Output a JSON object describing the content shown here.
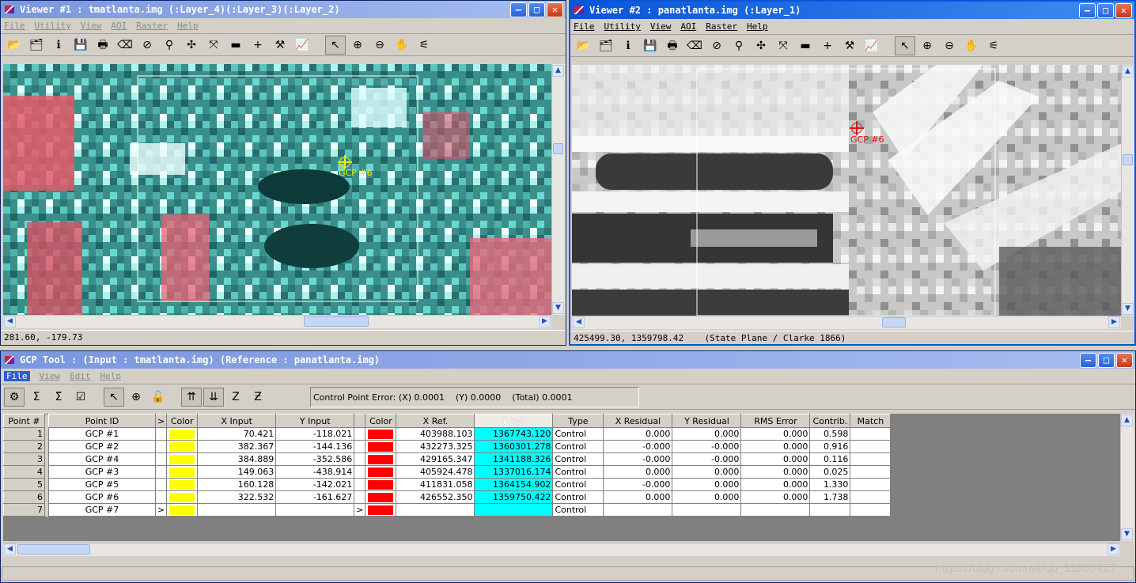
{
  "viewer1": {
    "title": "Viewer #1 : tmatlanta.img (:Layer_4)(:Layer_3)(:Layer_2)",
    "menu": [
      "File",
      "Utility",
      "View",
      "AOI",
      "Raster",
      "Help"
    ],
    "gcp_label": "GCP #6",
    "gcp_color": "#f0f000",
    "status": "281.60, -179.73"
  },
  "viewer2": {
    "title": "Viewer #2 : panatlanta.img (:Layer_1)",
    "menu": [
      "File",
      "Utility",
      "View",
      "AOI",
      "Raster",
      "Help"
    ],
    "gcp_label": "GCP #6",
    "gcp_color": "#e01010",
    "status": "425499.30, 1359798.42    (State Plane / Clarke 1866)"
  },
  "gcp_tool": {
    "title": "GCP Tool : (Input : tmatlanta.img) (Reference : panatlanta.img)",
    "menu": [
      "File",
      "View",
      "Edit",
      "Help"
    ],
    "error_label": "Control Point Error: (X) 0.0001",
    "error_y": "(Y) 0.0000",
    "error_total": "(Total) 0.0001",
    "columns": [
      "Point #",
      "Point ID",
      ">",
      "Color",
      "X Input",
      "Y Input",
      "Color",
      "X Ref.",
      "Y Ref.",
      "Type",
      "X Residual",
      "Y Residual",
      "RMS Error",
      "Contrib.",
      "Match"
    ],
    "input_color": "#ffff00",
    "ref_color": "#ff0000",
    "rows": [
      {
        "num": "1",
        "id": "GCP #1",
        "arrow": "",
        "xin": "70.421",
        "yin": "-118.021",
        "arrow2": "",
        "xref": "403988.103",
        "yref": "1367743.120",
        "type": "Control",
        "xres": "0.000",
        "yres": "0.000",
        "rms": "0.000",
        "contrib": "0.598"
      },
      {
        "num": "2",
        "id": "GCP #2",
        "arrow": "",
        "xin": "382.367",
        "yin": "-144.136",
        "arrow2": "",
        "xref": "432273.325",
        "yref": "1360301.278",
        "type": "Control",
        "xres": "-0.000",
        "yres": "-0.000",
        "rms": "0.000",
        "contrib": "0.916"
      },
      {
        "num": "3",
        "id": "GCP #4",
        "arrow": "",
        "xin": "384.889",
        "yin": "-352.586",
        "arrow2": "",
        "xref": "429165.347",
        "yref": "1341188.326",
        "type": "Control",
        "xres": "-0.000",
        "yres": "-0.000",
        "rms": "0.000",
        "contrib": "0.116"
      },
      {
        "num": "4",
        "id": "GCP #3",
        "arrow": "",
        "xin": "149.063",
        "yin": "-438.914",
        "arrow2": "",
        "xref": "405924.478",
        "yref": "1337016.174",
        "type": "Control",
        "xres": "0.000",
        "yres": "0.000",
        "rms": "0.000",
        "contrib": "0.025"
      },
      {
        "num": "5",
        "id": "GCP #5",
        "arrow": "",
        "xin": "160.128",
        "yin": "-142.021",
        "arrow2": "",
        "xref": "411831.058",
        "yref": "1364154.902",
        "type": "Control",
        "xres": "-0.000",
        "yres": "0.000",
        "rms": "0.000",
        "contrib": "1.330"
      },
      {
        "num": "6",
        "id": "GCP #6",
        "arrow": "",
        "xin": "322.532",
        "yin": "-161.627",
        "arrow2": "",
        "xref": "426552.350",
        "yref": "1359750.422",
        "type": "Control",
        "xres": "0.000",
        "yres": "0.000",
        "rms": "0.000",
        "contrib": "1.738"
      },
      {
        "num": "7",
        "id": "GCP #7",
        "arrow": ">",
        "xin": "",
        "yin": "",
        "arrow2": ">",
        "xref": "",
        "yref": "",
        "type": "Control",
        "xres": "",
        "yres": "",
        "rms": "",
        "contrib": ""
      }
    ]
  },
  "watermark": "https://blog.csdn.net/qq_31800427"
}
